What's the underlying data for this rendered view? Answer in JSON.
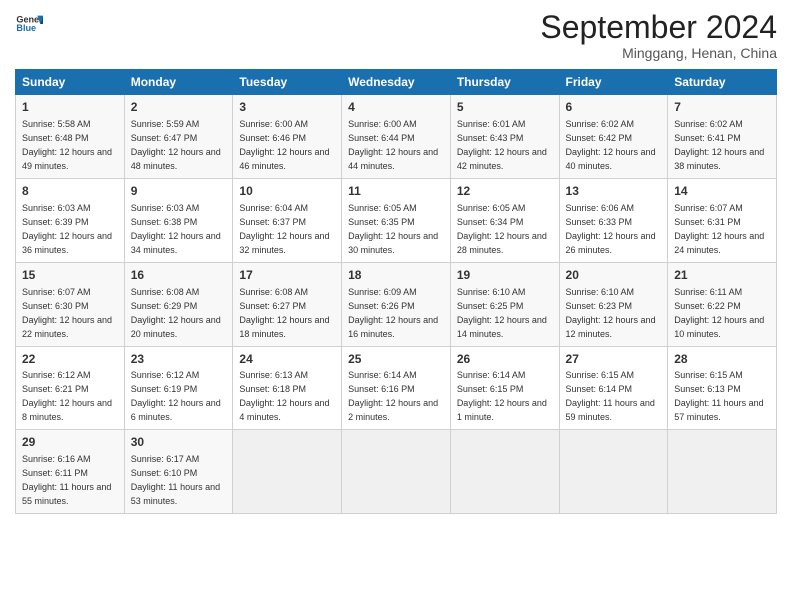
{
  "header": {
    "logo_line1": "General",
    "logo_line2": "Blue",
    "month": "September 2024",
    "location": "Minggang, Henan, China"
  },
  "weekdays": [
    "Sunday",
    "Monday",
    "Tuesday",
    "Wednesday",
    "Thursday",
    "Friday",
    "Saturday"
  ],
  "weeks": [
    [
      {
        "day": "1",
        "sunrise": "5:58 AM",
        "sunset": "6:48 PM",
        "daylight": "12 hours and 49 minutes."
      },
      {
        "day": "2",
        "sunrise": "5:59 AM",
        "sunset": "6:47 PM",
        "daylight": "12 hours and 48 minutes."
      },
      {
        "day": "3",
        "sunrise": "6:00 AM",
        "sunset": "6:46 PM",
        "daylight": "12 hours and 46 minutes."
      },
      {
        "day": "4",
        "sunrise": "6:00 AM",
        "sunset": "6:44 PM",
        "daylight": "12 hours and 44 minutes."
      },
      {
        "day": "5",
        "sunrise": "6:01 AM",
        "sunset": "6:43 PM",
        "daylight": "12 hours and 42 minutes."
      },
      {
        "day": "6",
        "sunrise": "6:02 AM",
        "sunset": "6:42 PM",
        "daylight": "12 hours and 40 minutes."
      },
      {
        "day": "7",
        "sunrise": "6:02 AM",
        "sunset": "6:41 PM",
        "daylight": "12 hours and 38 minutes."
      }
    ],
    [
      {
        "day": "8",
        "sunrise": "6:03 AM",
        "sunset": "6:39 PM",
        "daylight": "12 hours and 36 minutes."
      },
      {
        "day": "9",
        "sunrise": "6:03 AM",
        "sunset": "6:38 PM",
        "daylight": "12 hours and 34 minutes."
      },
      {
        "day": "10",
        "sunrise": "6:04 AM",
        "sunset": "6:37 PM",
        "daylight": "12 hours and 32 minutes."
      },
      {
        "day": "11",
        "sunrise": "6:05 AM",
        "sunset": "6:35 PM",
        "daylight": "12 hours and 30 minutes."
      },
      {
        "day": "12",
        "sunrise": "6:05 AM",
        "sunset": "6:34 PM",
        "daylight": "12 hours and 28 minutes."
      },
      {
        "day": "13",
        "sunrise": "6:06 AM",
        "sunset": "6:33 PM",
        "daylight": "12 hours and 26 minutes."
      },
      {
        "day": "14",
        "sunrise": "6:07 AM",
        "sunset": "6:31 PM",
        "daylight": "12 hours and 24 minutes."
      }
    ],
    [
      {
        "day": "15",
        "sunrise": "6:07 AM",
        "sunset": "6:30 PM",
        "daylight": "12 hours and 22 minutes."
      },
      {
        "day": "16",
        "sunrise": "6:08 AM",
        "sunset": "6:29 PM",
        "daylight": "12 hours and 20 minutes."
      },
      {
        "day": "17",
        "sunrise": "6:08 AM",
        "sunset": "6:27 PM",
        "daylight": "12 hours and 18 minutes."
      },
      {
        "day": "18",
        "sunrise": "6:09 AM",
        "sunset": "6:26 PM",
        "daylight": "12 hours and 16 minutes."
      },
      {
        "day": "19",
        "sunrise": "6:10 AM",
        "sunset": "6:25 PM",
        "daylight": "12 hours and 14 minutes."
      },
      {
        "day": "20",
        "sunrise": "6:10 AM",
        "sunset": "6:23 PM",
        "daylight": "12 hours and 12 minutes."
      },
      {
        "day": "21",
        "sunrise": "6:11 AM",
        "sunset": "6:22 PM",
        "daylight": "12 hours and 10 minutes."
      }
    ],
    [
      {
        "day": "22",
        "sunrise": "6:12 AM",
        "sunset": "6:21 PM",
        "daylight": "12 hours and 8 minutes."
      },
      {
        "day": "23",
        "sunrise": "6:12 AM",
        "sunset": "6:19 PM",
        "daylight": "12 hours and 6 minutes."
      },
      {
        "day": "24",
        "sunrise": "6:13 AM",
        "sunset": "6:18 PM",
        "daylight": "12 hours and 4 minutes."
      },
      {
        "day": "25",
        "sunrise": "6:14 AM",
        "sunset": "6:16 PM",
        "daylight": "12 hours and 2 minutes."
      },
      {
        "day": "26",
        "sunrise": "6:14 AM",
        "sunset": "6:15 PM",
        "daylight": "12 hours and 1 minute."
      },
      {
        "day": "27",
        "sunrise": "6:15 AM",
        "sunset": "6:14 PM",
        "daylight": "11 hours and 59 minutes."
      },
      {
        "day": "28",
        "sunrise": "6:15 AM",
        "sunset": "6:13 PM",
        "daylight": "11 hours and 57 minutes."
      }
    ],
    [
      {
        "day": "29",
        "sunrise": "6:16 AM",
        "sunset": "6:11 PM",
        "daylight": "11 hours and 55 minutes."
      },
      {
        "day": "30",
        "sunrise": "6:17 AM",
        "sunset": "6:10 PM",
        "daylight": "11 hours and 53 minutes."
      },
      null,
      null,
      null,
      null,
      null
    ]
  ]
}
